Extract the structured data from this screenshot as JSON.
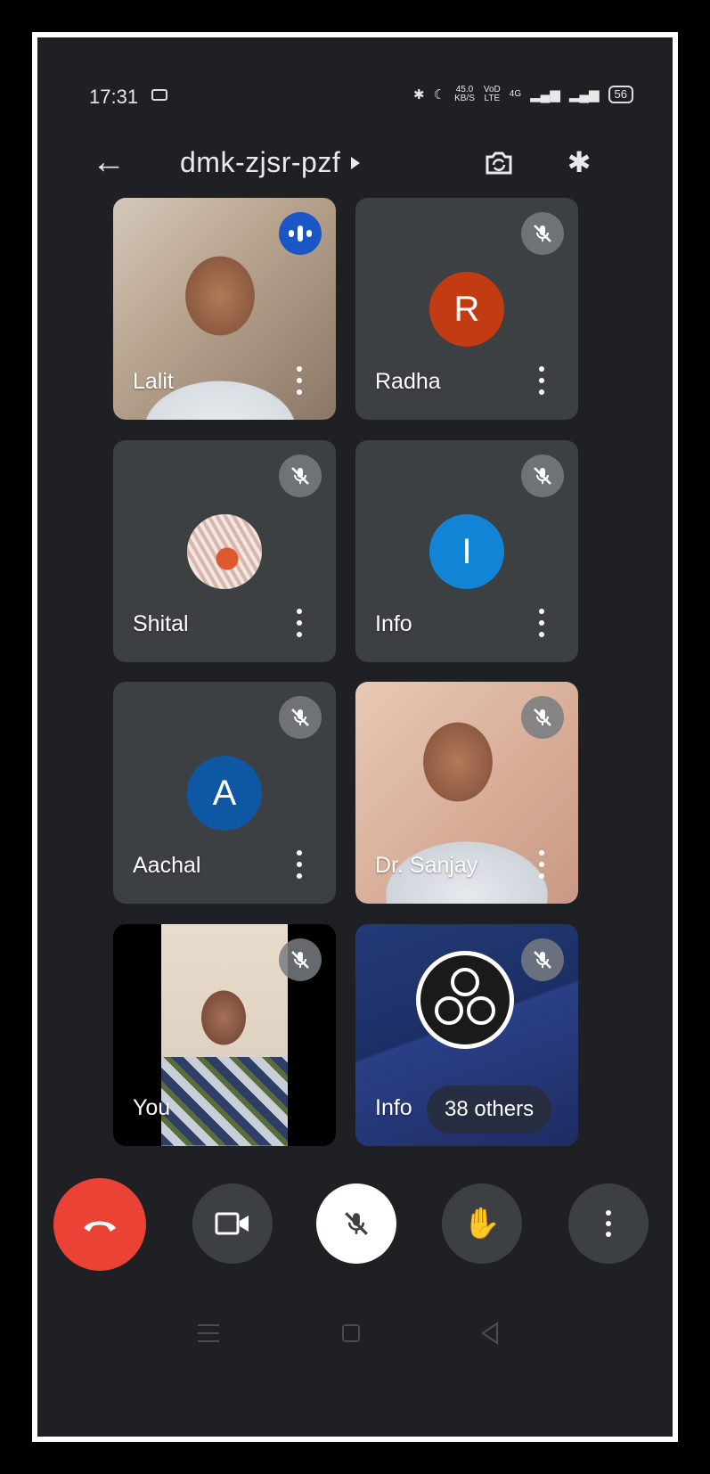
{
  "status_bar": {
    "time": "17:31",
    "net_speed_value": "45.0",
    "net_speed_unit": "KB/S",
    "volte_top": "VoD",
    "volte_bottom": "LTE",
    "network": "4G",
    "battery": "56"
  },
  "header": {
    "meeting_code": "dmk-zjsr-pzf"
  },
  "participants": [
    {
      "name": "Lalit",
      "kind": "video",
      "status": "speaking"
    },
    {
      "name": "Radha",
      "kind": "avatar",
      "initial": "R",
      "color": "#c23b12",
      "status": "muted"
    },
    {
      "name": "Shital",
      "kind": "photo",
      "status": "muted"
    },
    {
      "name": "Info",
      "kind": "avatar",
      "initial": "I",
      "color": "#1284d6",
      "status": "muted"
    },
    {
      "name": "Aachal",
      "kind": "avatar",
      "initial": "A",
      "color": "#0e58a3",
      "status": "muted"
    },
    {
      "name": "Dr. Sanjay",
      "kind": "video",
      "status": "muted"
    },
    {
      "name": "You",
      "kind": "video",
      "status": "muted"
    },
    {
      "name": "Info",
      "kind": "video",
      "status": "muted"
    }
  ],
  "others_pill": "38 others",
  "controls": {
    "end_call": "end-call",
    "camera": "camera",
    "mic": "mic-off",
    "raise_hand": "raise-hand",
    "more": "more"
  },
  "colors": {
    "end_call": "#ea4335",
    "speaking_indicator": "#1a56c5",
    "background": "#1f2023"
  }
}
